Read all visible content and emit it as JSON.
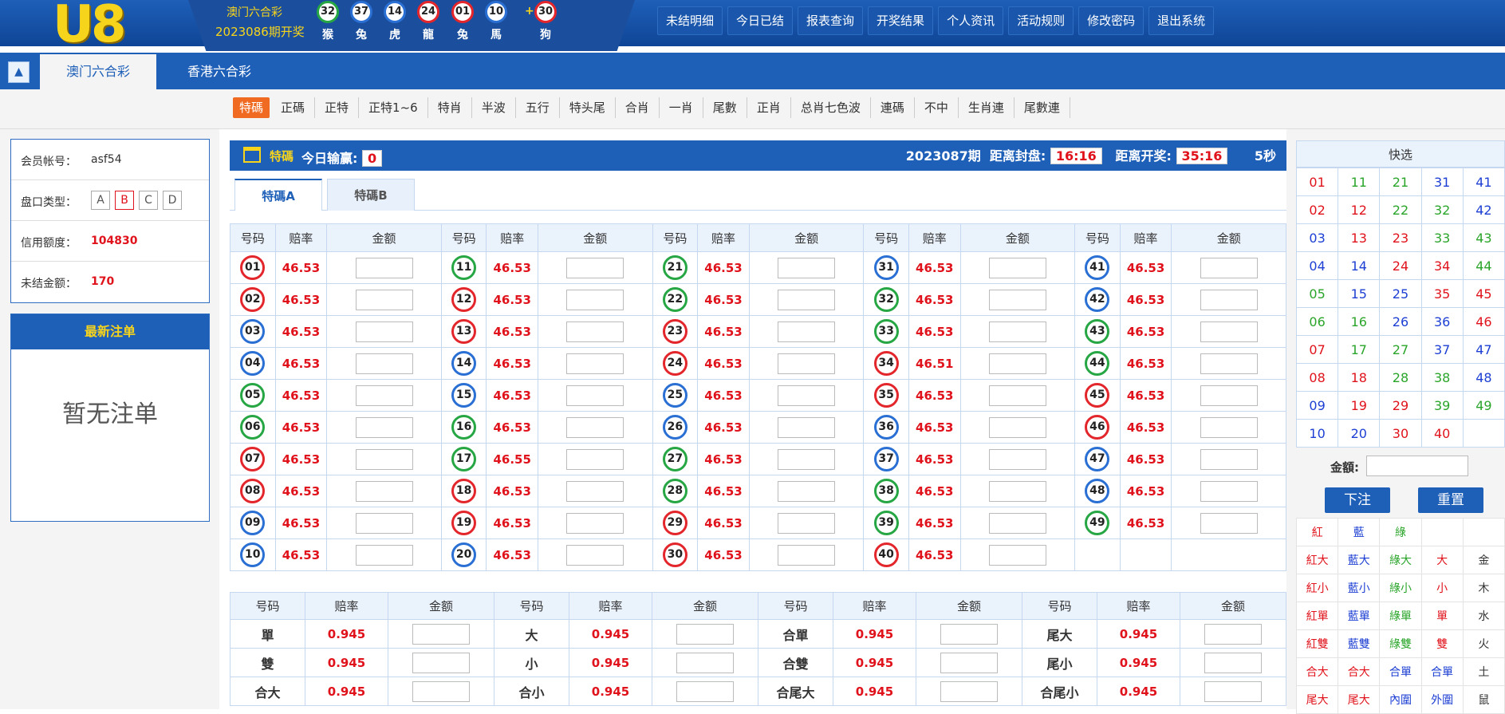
{
  "header": {
    "logo": "U8",
    "lottery_name": "澳门六合彩",
    "issue_open": "2023086期开奖",
    "results": [
      {
        "num": "32",
        "zodiac": "猴"
      },
      {
        "num": "37",
        "zodiac": "兔"
      },
      {
        "num": "14",
        "zodiac": "虎"
      },
      {
        "num": "24",
        "zodiac": "龍"
      },
      {
        "num": "01",
        "zodiac": "兔"
      },
      {
        "num": "10",
        "zodiac": "馬"
      },
      {
        "num": "30",
        "zodiac": "狗"
      }
    ],
    "plus": "+",
    "menu": [
      "未结明细",
      "今日已结",
      "报表查询",
      "开奖结果",
      "个人资讯",
      "活动规则",
      "修改密码",
      "退出系统"
    ]
  },
  "tabs": {
    "collapse": "▲",
    "macau": "澳门六合彩",
    "hongkong": "香港六合彩"
  },
  "subnav": [
    "特碼",
    "正碼",
    "正特",
    "正特1~6",
    "特肖",
    "半波",
    "五行",
    "特头尾",
    "合肖",
    "一肖",
    "尾數",
    "正肖",
    "总肖七色波",
    "連碼",
    "不中",
    "生肖連",
    "尾數連"
  ],
  "member": {
    "account_label": "会员帐号：",
    "account": "asf54",
    "type_label": "盘口类型：",
    "types": [
      "A",
      "B",
      "C",
      "D"
    ],
    "selected_type": "B",
    "credit_label": "信用额度：",
    "credit": "104830",
    "unsettled_label": "未结金额：",
    "unsettled": "170"
  },
  "latest": {
    "title": "最新注单",
    "empty": "暂无注单"
  },
  "mainbar": {
    "title": "特碼",
    "today_label": "今日输赢:",
    "today_value": "0",
    "issue": "2023087期",
    "close_label": "距离封盘:",
    "close_time": "16:16",
    "draw_label": "距离开奖:",
    "draw_time": "35:16",
    "refresh": "5秒"
  },
  "subtabs": [
    "特碼A",
    "特碼B"
  ],
  "table_headers": [
    "号码",
    "赔率",
    "金额"
  ],
  "odds": {
    "01": "46.53",
    "02": "46.53",
    "03": "46.53",
    "04": "46.53",
    "05": "46.53",
    "06": "46.53",
    "07": "46.53",
    "08": "46.53",
    "09": "46.53",
    "10": "46.53",
    "11": "46.53",
    "12": "46.53",
    "13": "46.53",
    "14": "46.53",
    "15": "46.53",
    "16": "46.53",
    "17": "46.55",
    "18": "46.53",
    "19": "46.53",
    "20": "46.53",
    "21": "46.53",
    "22": "46.53",
    "23": "46.53",
    "24": "46.53",
    "25": "46.53",
    "26": "46.53",
    "27": "46.53",
    "28": "46.53",
    "29": "46.53",
    "30": "46.53",
    "31": "46.53",
    "32": "46.53",
    "33": "46.53",
    "34": "46.51",
    "35": "46.53",
    "36": "46.53",
    "37": "46.53",
    "38": "46.53",
    "39": "46.53",
    "40": "46.53",
    "41": "46.53",
    "42": "46.53",
    "43": "46.53",
    "44": "46.53",
    "45": "46.53",
    "46": "46.53",
    "47": "46.53",
    "48": "46.53",
    "49": "46.53"
  },
  "ball_colors": {
    "red": "#e3262b",
    "blue": "#2a6fd3",
    "green": "#27a644"
  },
  "red_nums": [
    "01",
    "02",
    "07",
    "08",
    "12",
    "13",
    "18",
    "19",
    "23",
    "24",
    "29",
    "30",
    "34",
    "35",
    "40",
    "45",
    "46"
  ],
  "blue_nums": [
    "03",
    "04",
    "09",
    "10",
    "14",
    "15",
    "20",
    "25",
    "26",
    "31",
    "36",
    "37",
    "41",
    "42",
    "47",
    "48"
  ],
  "green_nums": [
    "05",
    "06",
    "11",
    "16",
    "17",
    "21",
    "22",
    "27",
    "28",
    "32",
    "33",
    "38",
    "39",
    "43",
    "44",
    "49"
  ],
  "side_bets": [
    [
      "單",
      "0.945",
      "大",
      "0.945",
      "合單",
      "0.945",
      "尾大",
      "0.945"
    ],
    [
      "雙",
      "0.945",
      "小",
      "0.945",
      "合雙",
      "0.945",
      "尾小",
      "0.945"
    ],
    [
      "合大",
      "0.945",
      "合小",
      "0.945",
      "合尾大",
      "0.945",
      "合尾小",
      "0.945"
    ]
  ],
  "quick": {
    "title": "快选",
    "amount_label": "金額:",
    "submit": "下注",
    "reset": "重置",
    "colors": [
      [
        "紅",
        "藍",
        "綠",
        "",
        ""
      ],
      [
        "紅大",
        "藍大",
        "綠大",
        "大",
        "金"
      ],
      [
        "紅小",
        "藍小",
        "綠小",
        "小",
        "木"
      ],
      [
        "紅單",
        "藍單",
        "綠單",
        "單",
        "水"
      ],
      [
        "紅雙",
        "藍雙",
        "綠雙",
        "雙",
        "火"
      ],
      [
        "合大",
        "合大",
        "合單",
        "合單",
        "土"
      ],
      [
        "尾大",
        "尾大",
        "內圍",
        "外圍",
        "鼠"
      ]
    ]
  }
}
